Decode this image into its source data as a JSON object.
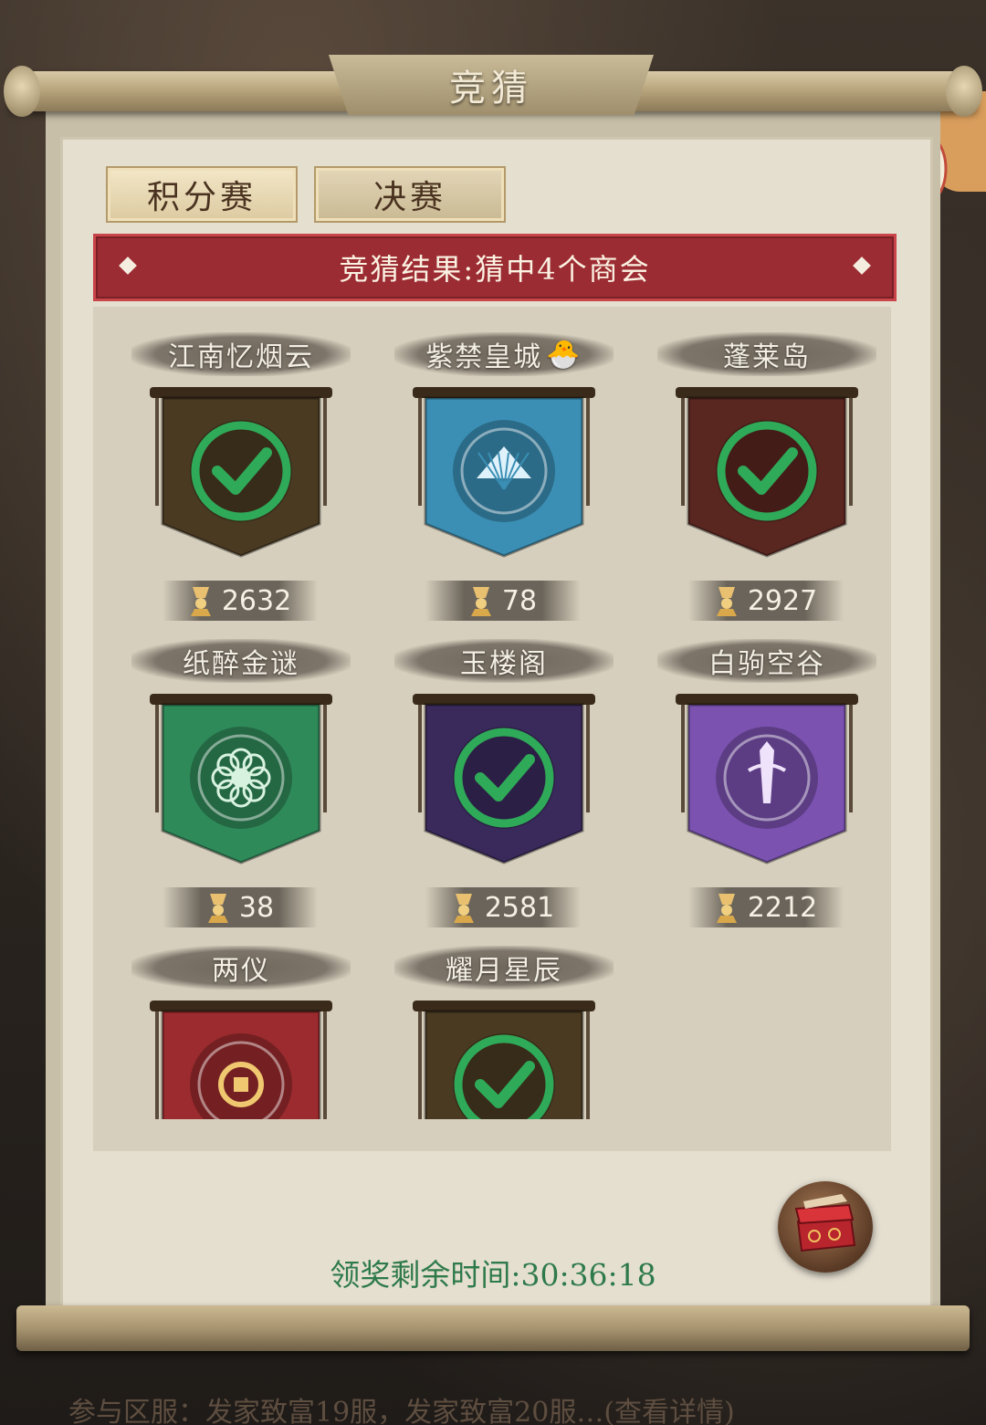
{
  "window": {
    "title": "竞猜"
  },
  "tabs": [
    {
      "label": "积分赛",
      "active": true
    },
    {
      "label": "决赛",
      "active": false
    }
  ],
  "result_banner": {
    "text": "竞猜结果:猜中4个商会"
  },
  "guilds": [
    {
      "name": "江南忆烟云",
      "count": "2632",
      "color": "#4a3a22",
      "icon": "check-icon",
      "correct": true
    },
    {
      "name": "紫禁皇城",
      "count": "78",
      "color": "#3b8fb5",
      "icon": "fan-icon",
      "correct": false,
      "badge": "chick-icon"
    },
    {
      "name": "蓬莱岛",
      "count": "2927",
      "color": "#5a2620",
      "icon": "check-icon",
      "correct": true
    },
    {
      "name": "纸醉金谜",
      "count": "38",
      "color": "#2f8a5a",
      "icon": "flower-icon",
      "correct": false
    },
    {
      "name": "玉楼阁",
      "count": "2581",
      "color": "#3a2a5c",
      "icon": "check-icon",
      "correct": true
    },
    {
      "name": "白驹空谷",
      "count": "2212",
      "color": "#7b52b0",
      "icon": "sword-icon",
      "correct": false
    },
    {
      "name": "两仪",
      "count": "",
      "color": "#9b2b2e",
      "icon": "coin-icon",
      "correct": false
    },
    {
      "name": "耀月星辰",
      "count": "",
      "color": "#4a3a22",
      "icon": "check-icon",
      "correct": true
    }
  ],
  "timer": {
    "text": "领奖剩余时间:30:36:18"
  },
  "footer": {
    "text": "参与区服：发家致富19服，发家致富20服…(查看详情)"
  },
  "icons": {
    "reward": "treasure-chest-icon",
    "medal": "trophy-medal-icon",
    "lantern": "lantern-icon"
  },
  "colors": {
    "accent_red": "#9c2c33",
    "timer_green": "#2e7a4a",
    "check_green": "#2faa58"
  }
}
